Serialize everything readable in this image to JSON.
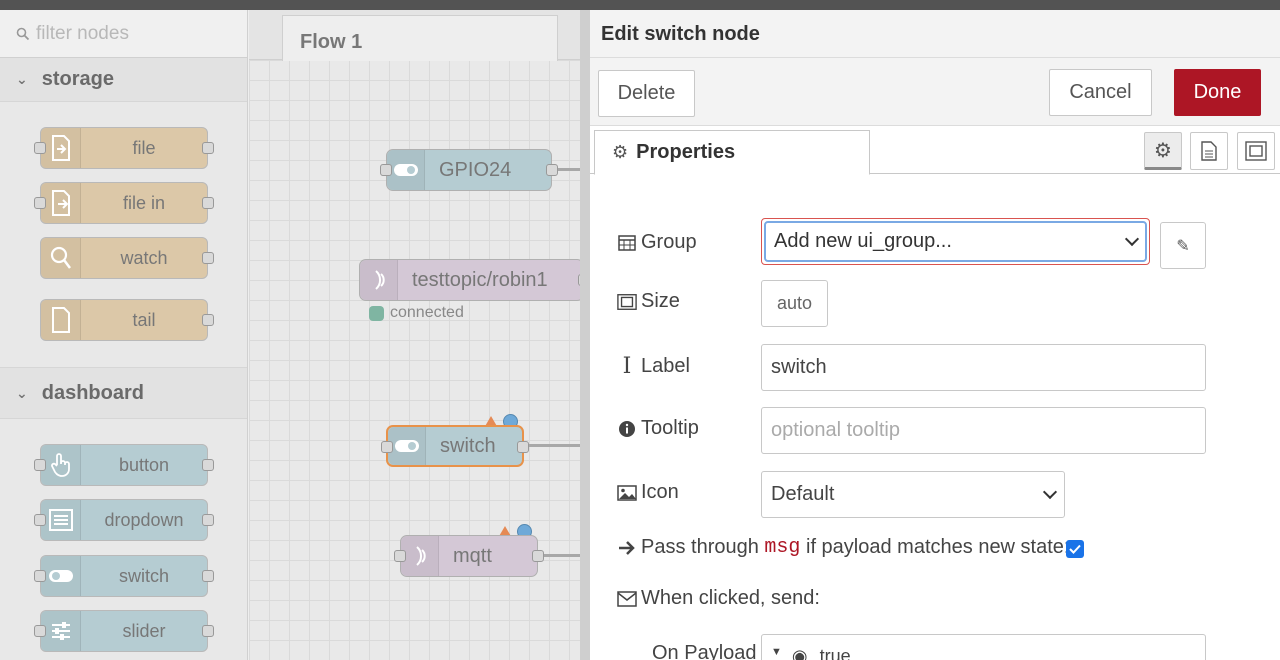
{
  "palette": {
    "filter_placeholder": "filter nodes",
    "categories": [
      {
        "label": "storage",
        "nodes": [
          "file",
          "file in",
          "watch",
          "tail"
        ]
      },
      {
        "label": "dashboard",
        "nodes": [
          "button",
          "dropdown",
          "switch",
          "slider"
        ]
      }
    ]
  },
  "workspace": {
    "tab": "Flow 1",
    "nodes": {
      "gpio": "GPIO24",
      "mqtt_in": "testtopic/robin1",
      "mqtt_in_status": "connected",
      "switch": "switch",
      "mqtt_out": "mqtt"
    }
  },
  "editor": {
    "title": "Edit switch node",
    "delete": "Delete",
    "cancel": "Cancel",
    "done": "Done",
    "tab_properties": "Properties",
    "group_label": "Group",
    "group_value": "Add new ui_group...",
    "size_label": "Size",
    "size_value": "auto",
    "label_label": "Label",
    "label_value": "switch",
    "tooltip_label": "Tooltip",
    "tooltip_placeholder": "optional tooltip",
    "icon_label": "Icon",
    "icon_value": "Default",
    "pass_prefix": "Pass through",
    "pass_code": "msg",
    "pass_suffix": "if payload matches new state:",
    "pass_checked": true,
    "when_clicked": "When clicked, send:",
    "on_payload_label": "On Payload",
    "on_payload_value": "true"
  },
  "colors": {
    "done": "#ad1625",
    "storage_node": "#dcc8a8",
    "dashboard_node": "#b5ccd2",
    "checkbox": "#1a73e8"
  }
}
